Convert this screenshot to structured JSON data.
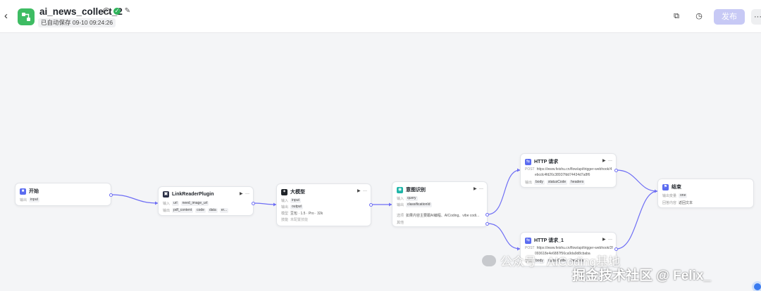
{
  "header": {
    "title": "ai_news_collect_2",
    "save_status": "已自动保存 09-10 09:24:26",
    "publish_label": "发布",
    "more_label": "···"
  },
  "colors": {
    "app_icon": "#3ebc63",
    "publish_bg": "#c7c9f5",
    "edge": "#6e6ef5",
    "canvas_bg": "#f4f5f7"
  },
  "icons": {
    "back": "chevron-left-icon",
    "info": "info-icon",
    "status_ok": "check-circle-icon",
    "edit": "edit-icon",
    "copy": "copy-icon",
    "history": "history-icon"
  },
  "nodes": {
    "start": {
      "title": "开始",
      "out_label": "输出",
      "out_tag": "input"
    },
    "link_reader": {
      "title": "LinkReaderPlugin",
      "in_label": "输入",
      "in_tags": [
        "url",
        "need_image_url"
      ],
      "out_label": "输出",
      "out_tags": [
        "pdf_content",
        "code",
        "data",
        "er..."
      ]
    },
    "llm": {
      "title": "大模型",
      "in_label": "输入",
      "in_tag": "input",
      "out_label": "输出",
      "out_tag": "output",
      "model_label": "模型",
      "model_value": "豆包 · 1.5 · Pro · 32k",
      "skill_label": "技能",
      "skill_value": "未配置技能"
    },
    "intent": {
      "title": "意图识别",
      "in_label": "输入",
      "in_tag": "query",
      "out_label": "输出",
      "out_tag": "classificationId",
      "opt_label": "选项",
      "opt_value": "如果内容主要跟AI编程、AICoding、vibe codi...",
      "other_label": "其他"
    },
    "http1": {
      "title": "HTTP 请求",
      "url_label": "POST",
      "url_line1": "https://www.feishu.cn/flow/api/trigger-webhook/4",
      "url_line2": "ebcdc4fd26c38937fdd74434d7a8f6",
      "out_label": "输出",
      "out_tags": [
        "body",
        "statusCode",
        "headers"
      ]
    },
    "http2": {
      "title": "HTTP 请求_1",
      "url_label": "POST",
      "url_line1": "https://www.feishu.cn/flow/api/trigger-webhook/2f",
      "url_line2": "093618e4e6887f56ca9da9d8cbaba",
      "out_label": "输出",
      "out_tags": [
        "body",
        "statusCode",
        "headers"
      ]
    },
    "end": {
      "title": "结束",
      "var_label": "输出变量",
      "var_tag": "one",
      "mode_label": "回答内容",
      "mode_value": "返回文本"
    }
  },
  "watermark": {
    "line1": "公众号 · AICoding基地",
    "line2": "掘金技术社区 @ Felix_"
  }
}
